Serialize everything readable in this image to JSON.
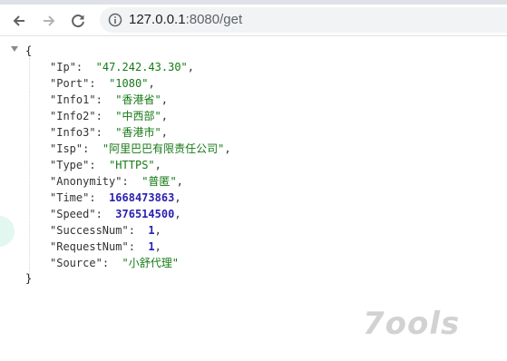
{
  "browser": {
    "url_host": "127.0.0.1",
    "url_rest": ":8080/get"
  },
  "json": {
    "open_brace": "{",
    "close_brace": "}",
    "entries": [
      {
        "key": "Ip",
        "value": "47.242.43.30",
        "type": "string"
      },
      {
        "key": "Port",
        "value": "1080",
        "type": "string"
      },
      {
        "key": "Info1",
        "value": "香港省",
        "type": "string"
      },
      {
        "key": "Info2",
        "value": "中西部",
        "type": "string"
      },
      {
        "key": "Info3",
        "value": "香港市",
        "type": "string"
      },
      {
        "key": "Isp",
        "value": "阿里巴巴有限责任公司",
        "type": "string"
      },
      {
        "key": "Type",
        "value": "HTTPS",
        "type": "string"
      },
      {
        "key": "Anonymity",
        "value": "普匿",
        "type": "string"
      },
      {
        "key": "Time",
        "value": "1668473863",
        "type": "number"
      },
      {
        "key": "Speed",
        "value": "376514500",
        "type": "number"
      },
      {
        "key": "SuccessNum",
        "value": "1",
        "type": "number"
      },
      {
        "key": "RequestNum",
        "value": "1",
        "type": "number"
      },
      {
        "key": "Source",
        "value": "小舒代理",
        "type": "string"
      }
    ]
  },
  "watermark": "7ools",
  "colors": {
    "string": "#157a15",
    "number": "#2a1fb0",
    "key": "#333333"
  }
}
